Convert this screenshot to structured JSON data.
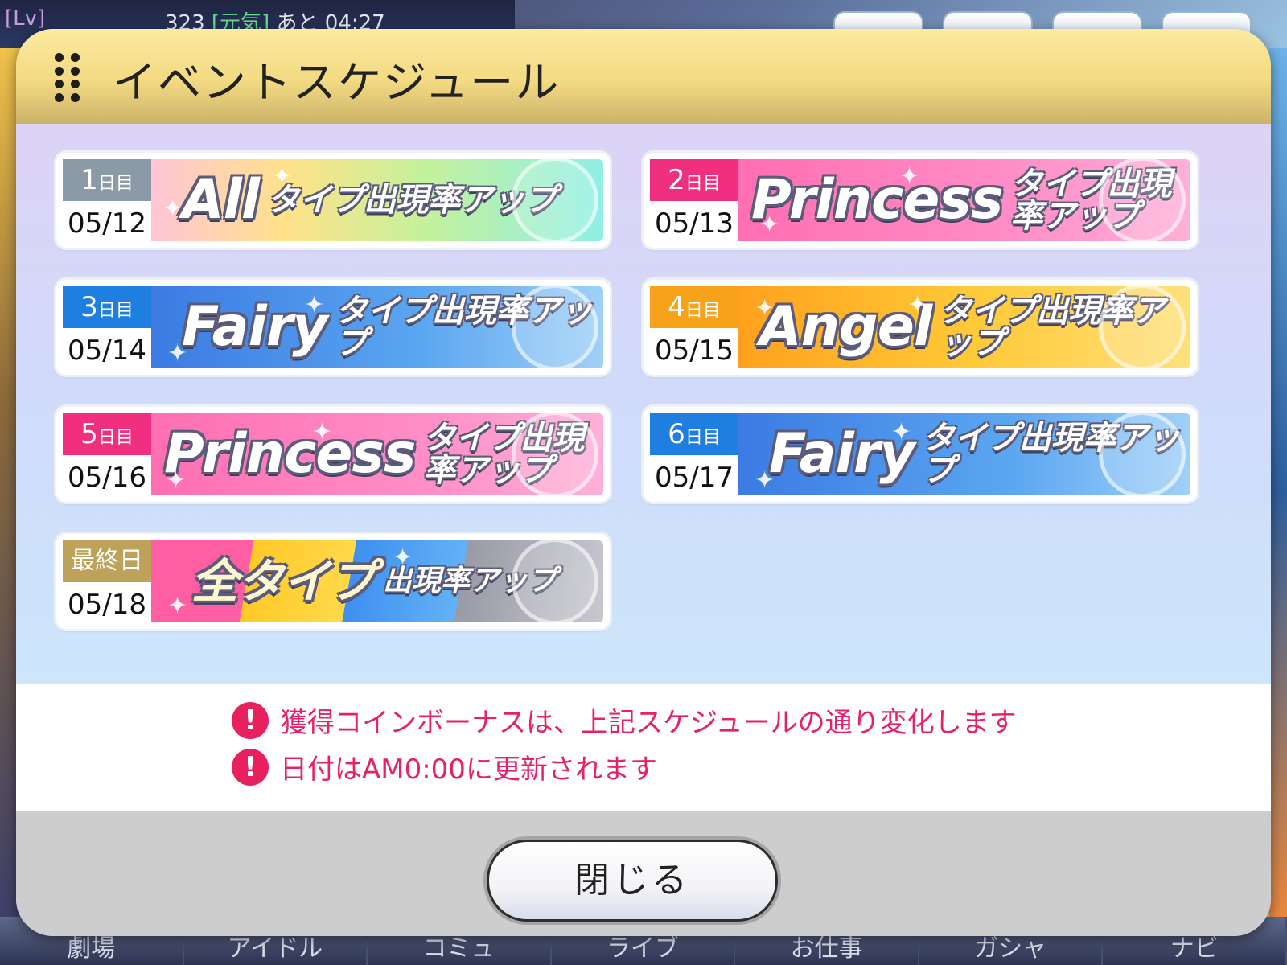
{
  "background": {
    "level_label": "[Lv]",
    "stamina_value": "323",
    "stamina_tag": "[元気]",
    "stamina_timer": "あと 04:27",
    "nav": [
      "劇場",
      "アイドル",
      "コミュ",
      "ライブ",
      "お仕事",
      "ガシャ",
      "ナビ"
    ]
  },
  "dialog": {
    "title": "イベントスケジュール",
    "schedule": [
      {
        "day_number": "1",
        "day_suffix": "日目",
        "date": "05/12",
        "type_word": "All",
        "banner_text": "タイプ出現率アップ",
        "color": "#8c9aa8"
      },
      {
        "day_number": "2",
        "day_suffix": "日目",
        "date": "05/13",
        "type_word": "Princess",
        "banner_text": "タイプ出現率アップ",
        "color": "#f0307e"
      },
      {
        "day_number": "3",
        "day_suffix": "日目",
        "date": "05/14",
        "type_word": "Fairy",
        "banner_text": "タイプ出現率アップ",
        "color": "#1e7fe0"
      },
      {
        "day_number": "4",
        "day_suffix": "日目",
        "date": "05/15",
        "type_word": "Angel",
        "banner_text": "タイプ出現率アップ",
        "color": "#f8a21a"
      },
      {
        "day_number": "5",
        "day_suffix": "日目",
        "date": "05/16",
        "type_word": "Princess",
        "banner_text": "タイプ出現率アップ",
        "color": "#f0307e"
      },
      {
        "day_number": "6",
        "day_suffix": "日目",
        "date": "05/17",
        "type_word": "Fairy",
        "banner_text": "タイプ出現率アップ",
        "color": "#1e7fe0"
      },
      {
        "day_label": "最終日",
        "date": "05/18",
        "type_word": "全タイプ",
        "banner_text": "出現率アップ",
        "color": "#bfa25a"
      }
    ],
    "notices": [
      "獲得コインボーナスは、上記スケジュールの通り変化します",
      "日付はAM0:00に更新されます"
    ],
    "notice_icon": "!",
    "close_label": "閉じる"
  }
}
